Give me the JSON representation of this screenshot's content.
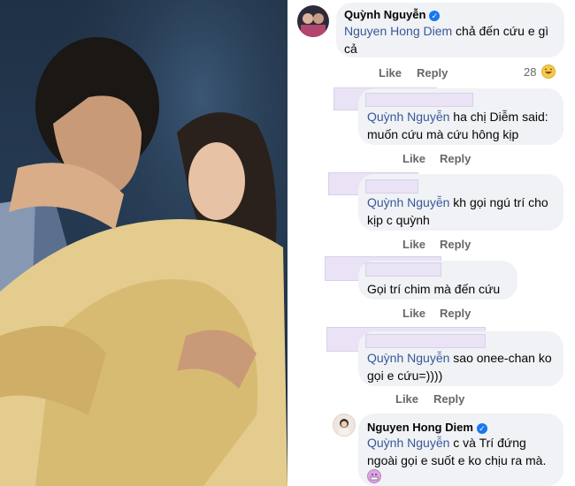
{
  "photo": {
    "alt": ""
  },
  "comments": [
    {
      "author": "Quỳnh Nguyễn",
      "verified": true,
      "mention": "Nguyen Hong Diem",
      "text": " chả đến cứu e gì cả",
      "actions": [
        "Like",
        "Reply"
      ],
      "reaction_count": "28",
      "reaction_icon": "haha-emoji-icon"
    },
    {
      "author_redacted": true,
      "mention": "Quỳnh Nguyễn",
      "text": "  ha chị Diễm said: muốn cứu mà cứu hông kịp",
      "actions": [
        "Like",
        "Reply"
      ]
    },
    {
      "author_redacted": true,
      "mention": "Quỳnh Nguyễn",
      "text": " kh gọi ngú trí cho kịp c quỳnh",
      "actions": [
        "Like",
        "Reply"
      ]
    },
    {
      "author_redacted": true,
      "mention": "",
      "text": "Gọi trí chim mà đến cứu",
      "actions": [
        "Like",
        "Reply"
      ]
    },
    {
      "author_redacted": true,
      "mention": "Quỳnh Nguyễn",
      "text": " sao onee-chan ko gọi e cứu=))))",
      "actions": [
        "Like",
        "Reply"
      ]
    },
    {
      "author": "Nguyen Hong Diem",
      "verified": true,
      "mention": "Quỳnh Nguyễn",
      "text": " c và Trí đứng ngoài gọi e suốt e ko chịu ra mà.",
      "reaction_icon": "grimace-emoji-icon"
    }
  ],
  "colors": {
    "mention": "#385898",
    "bubble": "#f0f2f5",
    "verified": "#1877f2",
    "action": "#65676b"
  }
}
